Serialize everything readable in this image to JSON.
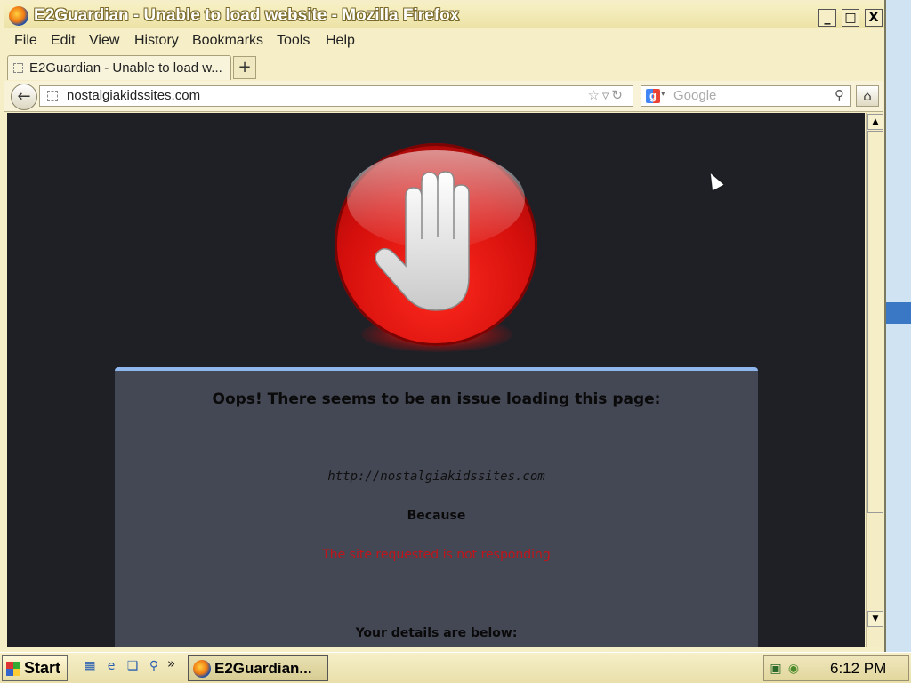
{
  "window": {
    "title": "E2Guardian - Unable to load website - Mozilla Firefox",
    "controls": {
      "minimize": "_",
      "maximize": "□",
      "close": "X"
    }
  },
  "menu": [
    "File",
    "Edit",
    "View",
    "History",
    "Bookmarks",
    "Tools",
    "Help"
  ],
  "tabs": [
    {
      "label": "E2Guardian - Unable to load w..."
    }
  ],
  "new_tab_label": "+",
  "navbar": {
    "url": "nostalgiakidssites.com",
    "search_placeholder": "Google"
  },
  "page": {
    "heading": "Oops! There seems to be an issue loading this page:",
    "requested_url": "http://nostalgiakidssites.com",
    "because_label": "Because",
    "reason": "The site requested is not responding",
    "details_label": "Your details are below:"
  },
  "taskbar": {
    "start_label": "Start",
    "task_label": "E2Guardian...",
    "clock": "6:12 PM",
    "quicklaunch_more": "»"
  },
  "colors": {
    "window_chrome": "#f5eec6",
    "page_background": "#1f2026",
    "panel_background": "#444754",
    "panel_accent": "#8fb7ee",
    "error_red": "#c0141a",
    "stop_red": "#d40f0c"
  },
  "icons": [
    "firefox-icon",
    "back-arrow-icon",
    "star-icon",
    "reload-icon",
    "google-icon",
    "search-icon",
    "home-icon",
    "stop-hand-icon",
    "windows-logo-icon"
  ]
}
